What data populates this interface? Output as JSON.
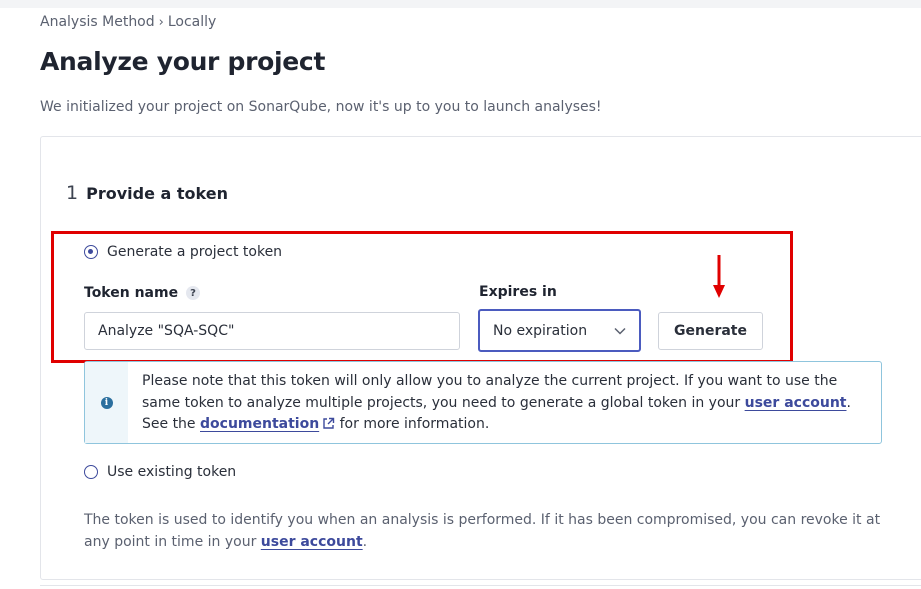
{
  "breadcrumb": {
    "parent": "Analysis Method",
    "separator": "›",
    "current": "Locally"
  },
  "page": {
    "title": "Analyze your project",
    "subtitle": "We initialized your project on SonarQube, now it's up to you to launch analyses!"
  },
  "step": {
    "number": "1",
    "title": "Provide a token"
  },
  "token_options": {
    "generate_label": "Generate a project token",
    "generate_selected": true,
    "existing_label": "Use existing token",
    "existing_selected": false
  },
  "token_form": {
    "name_label": "Token name",
    "help_icon": "question-mark-icon",
    "name_value": "Analyze \"SQA-SQC\"",
    "expires_label": "Expires in",
    "expires_value": "No expiration",
    "generate_button": "Generate"
  },
  "info": {
    "icon": "info-icon",
    "line1": "Please note that this token will only allow you to analyze the current project. If you want to use the",
    "line2_before": "same token to analyze multiple projects, you need to generate a global token in your",
    "line2_link": "user account",
    "line2_after": ".",
    "line3_before": "See the",
    "line3_link": "documentation",
    "line3_after": " for more information."
  },
  "footer_note": {
    "text_before": "The token is used to identify you when an analysis is performed. If it has been compromised, you can revoke it at any point in time in your",
    "link": "user account",
    "text_after": "."
  },
  "colors": {
    "highlight_box": "#e00000",
    "accent": "#3d4a9c",
    "info_border": "#8fc5dd"
  }
}
